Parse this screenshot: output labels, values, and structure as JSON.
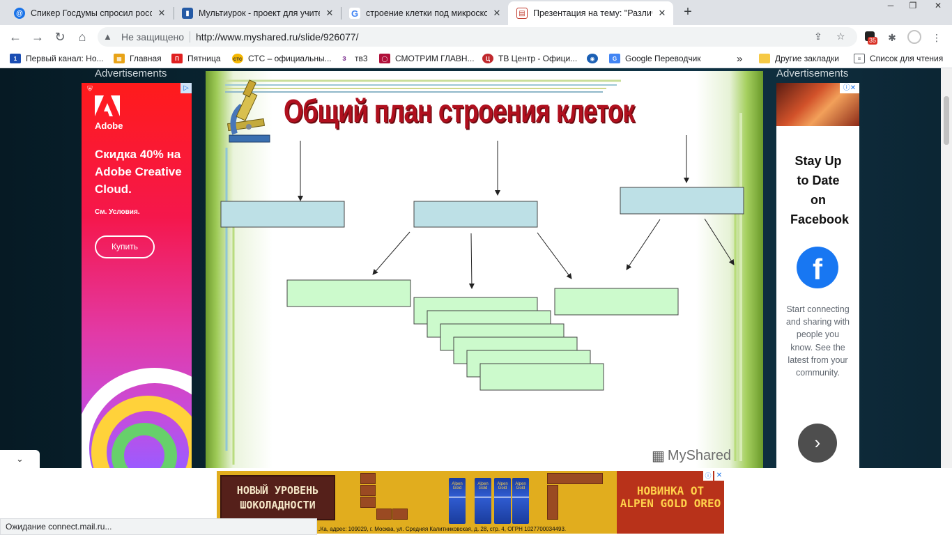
{
  "browser": {
    "tabs": [
      {
        "title": "Спикер Госдумы спросил росси",
        "icon": "mail-icon",
        "color": "#1a73e8"
      },
      {
        "title": "Мультиурок - проект для учите",
        "icon": "book-icon",
        "color": "#245aa5"
      },
      {
        "title": "строение клетки под микроско",
        "icon": "google-icon",
        "color": "#4285f4"
      },
      {
        "title": "Презентация на тему: \"Различи",
        "icon": "presentation-icon",
        "color": "#c0392b"
      }
    ],
    "nav": {
      "security_label": "Не защищено",
      "url": "http://www.myshared.ru/slide/926077/"
    },
    "ext_badge": "35",
    "bookmarks": [
      {
        "label": "Первый канал: Но...",
        "icon": "channel-one-icon",
        "color": "#1a4db3"
      },
      {
        "label": "Главная",
        "icon": "home-channel-icon",
        "color": "#e8a317"
      },
      {
        "label": "Пятница",
        "icon": "pyatnitsa-icon",
        "color": "#e02020"
      },
      {
        "label": "СТС – официальны...",
        "icon": "sts-icon",
        "color": "#f5b700"
      },
      {
        "label": "тв3",
        "icon": "tv3-icon",
        "color": "#7b2d8e"
      },
      {
        "label": "СМОТРИМ ГЛАВН...",
        "icon": "smotrim-icon",
        "color": "#b0103a"
      },
      {
        "label": "ТВ Центр - Офици...",
        "icon": "tvc-icon",
        "color": "#c0282d"
      },
      {
        "label": "",
        "icon": "vpn-shield-icon",
        "color": "#1a5fb4"
      },
      {
        "label": "Google Переводчик",
        "icon": "translate-icon",
        "color": "#4285f4"
      }
    ],
    "overflow": "»",
    "other_bookmarks": "Другие закладки",
    "reading_list": "Список для чтения",
    "status": "Ожидание connect.mail.ru..."
  },
  "page": {
    "ad_label": "Advertisements",
    "ad_left": {
      "brand": "Adobe",
      "headline": "Скидка 40% на Adobe Creative Cloud.",
      "terms": "См. Условия.",
      "cta": "Купить"
    },
    "slide": {
      "title": "Общий план строения клеток",
      "watermark": "MyShared",
      "colors": {
        "blue_box": "#bde0e6",
        "green_box": "#ccfacc",
        "title": "#b0101e"
      }
    },
    "ad_right": {
      "headline": "Stay Up to Date on Facebook",
      "description": "Start connecting and sharing with people you know. See the latest from your community.",
      "cta_icon": "chevron-right-icon"
    }
  },
  "bottom_ad": {
    "left_text": "НОВЫЙ УРОВЕНЬ ШОКОЛАДНОСТИ",
    "right_text": "НОВИНКА ОТ ALPEN GOLD OREO",
    "pack_label": "Alpen Gold",
    "legal": "...Ка, адрес: 109029, г. Москва, ул. Средняя Калитниковская, д. 28, стр. 4, ОГРН 1027700034493."
  }
}
